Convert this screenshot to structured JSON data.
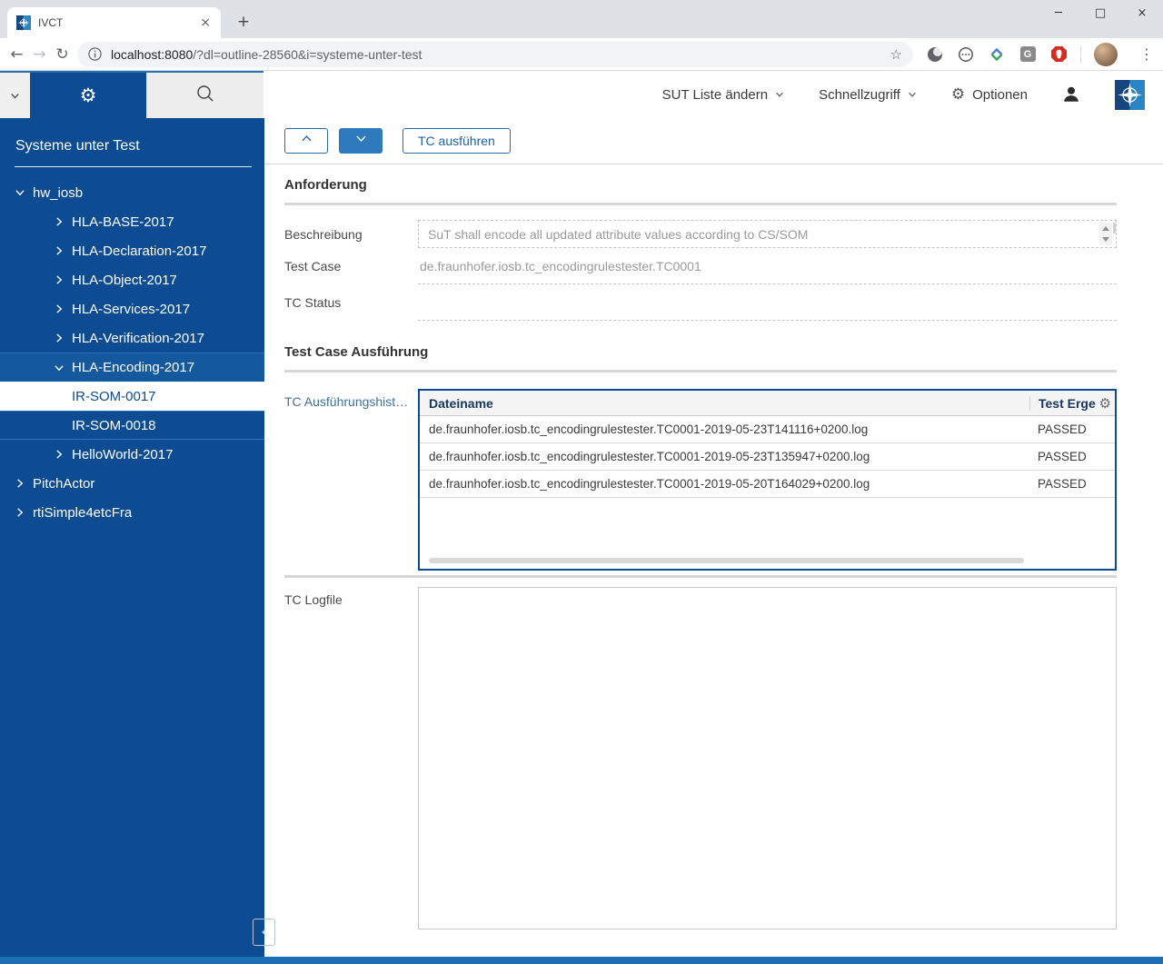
{
  "browser": {
    "tab_title": "IVCT",
    "url": {
      "host": "localhost:8080",
      "path": "/?dl=outline-28560&i=systeme-unter-test"
    }
  },
  "icons": {
    "minimize": "─",
    "maximize": "□",
    "close": "×",
    "tab_close": "×",
    "new_tab": "+",
    "back": "←",
    "forward": "→",
    "reload": "↻",
    "bookmark_star": "☆",
    "overflow_menu": "⋮",
    "gear": "⚙",
    "extension_g": "G"
  },
  "app_header": {
    "sut_menu": "SUT Liste ändern",
    "quick_menu": "Schnellzugriff",
    "options_label": "Optionen"
  },
  "sidebar": {
    "title": "Systeme unter Test",
    "tree": [
      {
        "label": "hw_iosb",
        "depth": 0,
        "chevron": "down",
        "state": "normal"
      },
      {
        "label": "HLA-BASE-2017",
        "depth": 1,
        "chevron": "right",
        "state": "normal"
      },
      {
        "label": "HLA-Declaration-2017",
        "depth": 1,
        "chevron": "right",
        "state": "normal"
      },
      {
        "label": "HLA-Object-2017",
        "depth": 1,
        "chevron": "right",
        "state": "normal"
      },
      {
        "label": "HLA-Services-2017",
        "depth": 1,
        "chevron": "right",
        "state": "normal"
      },
      {
        "label": "HLA-Verification-2017",
        "depth": 1,
        "chevron": "right",
        "state": "normal"
      },
      {
        "label": "HLA-Encoding-2017",
        "depth": 1,
        "chevron": "down",
        "state": "highlight"
      },
      {
        "label": "IR-SOM-0017",
        "depth": 2,
        "chevron": "none",
        "state": "selected"
      },
      {
        "label": "IR-SOM-0018",
        "depth": 2,
        "chevron": "none",
        "state": "grouped"
      },
      {
        "label": "HelloWorld-2017",
        "depth": 1,
        "chevron": "right",
        "state": "normal"
      },
      {
        "label": "PitchActor",
        "depth": 0,
        "chevron": "right",
        "state": "normal"
      },
      {
        "label": "rtiSimple4etcFra",
        "depth": 0,
        "chevron": "right",
        "state": "normal"
      }
    ]
  },
  "toolbar": {
    "run_button": "TC ausführen"
  },
  "requirement": {
    "heading": "Anforderung",
    "description_label": "Beschreibung",
    "description_value": "SuT shall encode all updated attribute values according to CS/SOM",
    "test_case_label": "Test Case",
    "test_case_value": "de.fraunhofer.iosb.tc_encodingrulestester.TC0001",
    "tc_status_label": "TC Status"
  },
  "execution": {
    "heading": "Test Case Ausführung",
    "history_label": "TC Ausführungshist…",
    "logfile_label": "TC Logfile",
    "table": {
      "columns": {
        "filename": "Dateiname",
        "result": "Test Erge"
      },
      "rows": [
        {
          "filename": "de.fraunhofer.iosb.tc_encodingrulestester.TC0001-2019-05-23T141116+0200.log",
          "result": "PASSED"
        },
        {
          "filename": "de.fraunhofer.iosb.tc_encodingrulestester.TC0001-2019-05-23T135947+0200.log",
          "result": "PASSED"
        },
        {
          "filename": "de.fraunhofer.iosb.tc_encodingrulestester.TC0001-2019-05-20T164029+0200.log",
          "result": "PASSED"
        }
      ]
    }
  },
  "colors": {
    "brand": "#0d4c92",
    "accent_button": "#2e7abc",
    "bottom_bar": "#1b6db4",
    "selected_row_bg": "#ffffff"
  }
}
